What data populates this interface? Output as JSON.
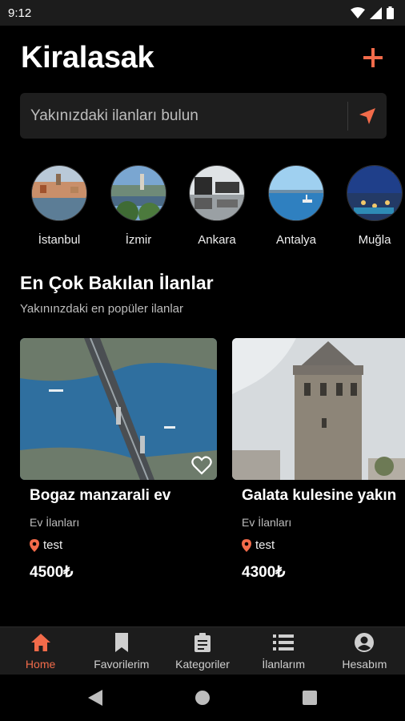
{
  "status_bar": {
    "time": "9:12"
  },
  "header": {
    "title": "Kiralasak",
    "add_icon": "plus-icon"
  },
  "search": {
    "placeholder": "Yakınızdaki ilanları bulun",
    "value": "",
    "locate_icon": "navigation-arrow-icon"
  },
  "cities": [
    {
      "label": "İstanbul"
    },
    {
      "label": "İzmir"
    },
    {
      "label": "Ankara"
    },
    {
      "label": "Antalya"
    },
    {
      "label": "Muğla"
    }
  ],
  "section": {
    "title": "En Çok Bakılan İlanlar",
    "subtitle": "Yakınınzdaki en popüler ilanlar"
  },
  "listings": [
    {
      "title": "Bogaz manzarali ev",
      "category": "Ev İlanları",
      "location": "test",
      "price": "4500₺",
      "favorite": false
    },
    {
      "title": "Galata kulesine yakın",
      "category": "Ev İlanları",
      "location": "test",
      "price": "4300₺",
      "favorite": false
    }
  ],
  "bottom_nav": [
    {
      "label": "Home",
      "icon": "home-icon",
      "active": true
    },
    {
      "label": "Favorilerim",
      "icon": "bookmark-icon",
      "active": false
    },
    {
      "label": "Kategoriler",
      "icon": "clipboard-icon",
      "active": false
    },
    {
      "label": "İlanlarım",
      "icon": "list-icon",
      "active": false
    },
    {
      "label": "Hesabım",
      "icon": "account-circle-icon",
      "active": false
    }
  ],
  "colors": {
    "accent": "#f26b4a",
    "background": "#000000",
    "surface": "#1c1c1c"
  }
}
